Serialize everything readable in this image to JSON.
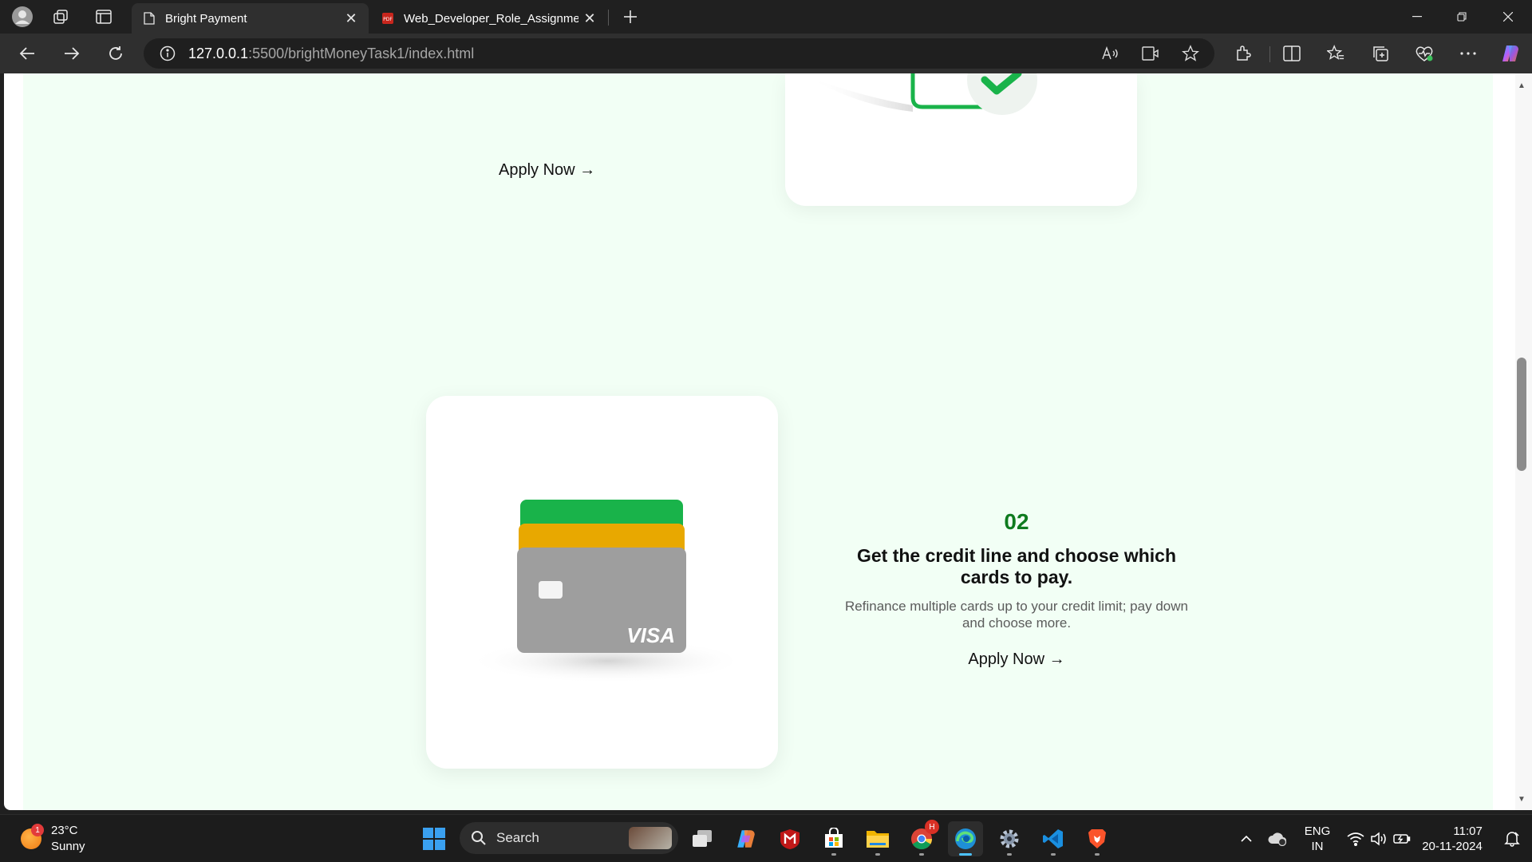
{
  "browser": {
    "tabs": [
      {
        "label": "Bright Payment",
        "active": true
      },
      {
        "label": "Web_Developer_Role_Assignment",
        "active": false
      }
    ],
    "address": {
      "host": "127.0.0.1",
      "path": ":5500/brightMoneyTask1/index.html"
    }
  },
  "page": {
    "top_apply_label": "Apply Now →",
    "step": {
      "number": "02",
      "title": "Get the credit line and choose which cards to pay.",
      "description": "Refinance multiple cards up to your credit limit; pay down and choose more.",
      "apply_label": "Apply Now →"
    },
    "card_brand": "VISA",
    "colors": {
      "page_background": "#f2fff5",
      "accent_green": "#0f7b1f",
      "card_green": "#19b34a",
      "card_yellow": "#e8a800",
      "card_grey": "#9e9e9e"
    }
  },
  "taskbar": {
    "weather": {
      "temp": "23°C",
      "condition": "Sunny",
      "badge": "1"
    },
    "search_label": "Search",
    "language": {
      "line1": "ENG",
      "line2": "IN"
    },
    "clock": {
      "time": "11:07",
      "date": "20-11-2024"
    },
    "chrome_badge": "H"
  }
}
